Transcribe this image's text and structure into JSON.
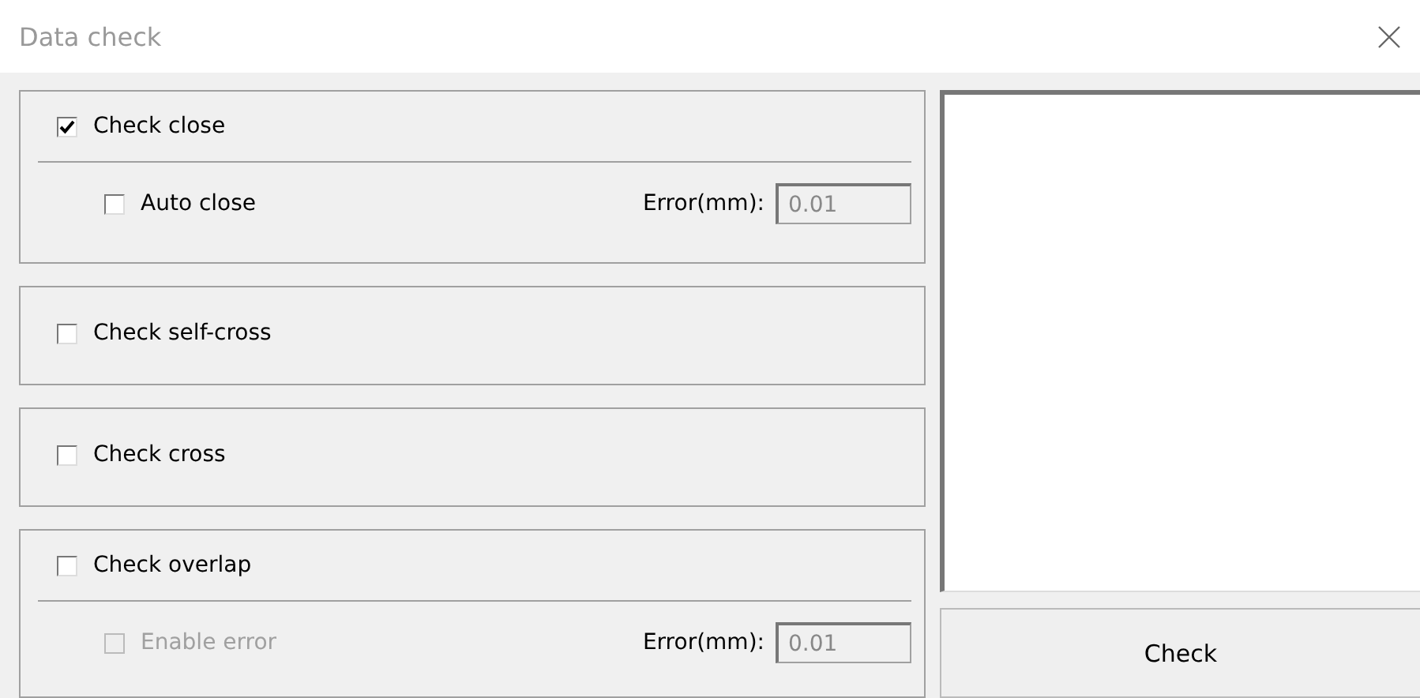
{
  "window": {
    "title": "Data check"
  },
  "groups": [
    {
      "label": "Check close",
      "checked": true,
      "option": {
        "label": "Auto close",
        "checked": false,
        "disabled": false,
        "error_label": "Error(mm):",
        "error_value": "0.01",
        "error_disabled": true
      }
    },
    {
      "label": "Check self-cross",
      "checked": false
    },
    {
      "label": "Check cross",
      "checked": false
    },
    {
      "label": "Check overlap",
      "checked": false,
      "option": {
        "label": "Enable error",
        "checked": false,
        "disabled": true,
        "error_label": "Error(mm):",
        "error_value": "0.01",
        "error_disabled": true
      }
    }
  ],
  "check_button": "Check"
}
